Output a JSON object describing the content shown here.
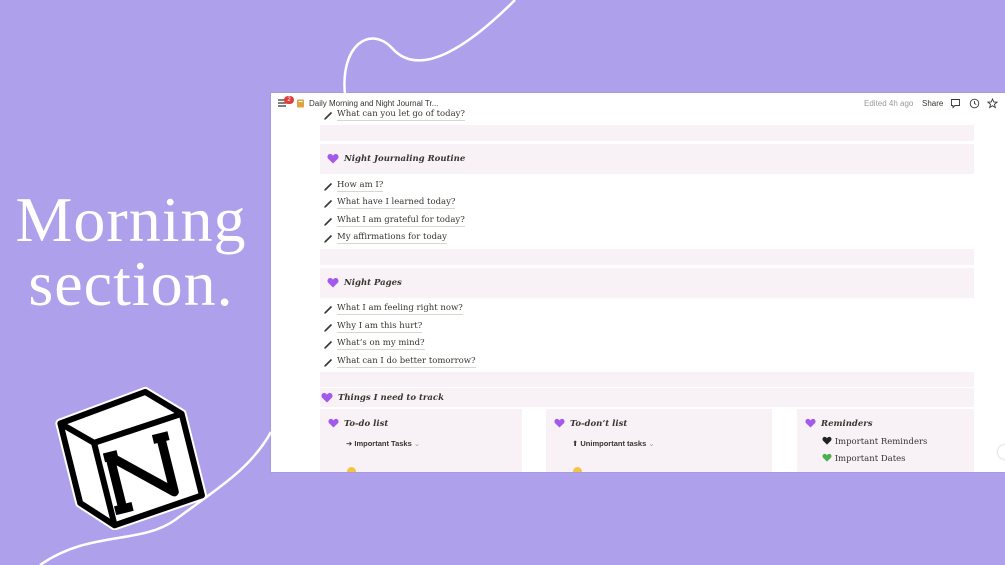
{
  "headline": {
    "line1": "Morning",
    "line2": "section."
  },
  "colors": {
    "background": "#afa0ec",
    "accent_heart": "#a259ec",
    "band": "#f8f1f6"
  },
  "app": {
    "title": "Daily Morning and Night Journal Tr...",
    "notification_count": "2",
    "edited": "Edited 4h ago",
    "share": "Share",
    "icons": [
      "menu-icon",
      "journal-icon",
      "comment-icon",
      "clock-icon",
      "star-icon"
    ]
  },
  "page": {
    "cut_off_item": "What can you let go of today?",
    "night_routine": {
      "heading": "Night Journaling Routine",
      "items": [
        "How am I?",
        "What have I learned today?",
        "What I am grateful for today?",
        "My affirmations for today"
      ]
    },
    "night_pages": {
      "heading": "Night Pages",
      "items": [
        "What I am feeling right now?",
        "Why I am this hurt?",
        "What’s on my mind?",
        "What can I do better tomorrow?"
      ]
    },
    "track": {
      "heading": "Things I need to track"
    },
    "cards": {
      "todo": {
        "title": "To-do list",
        "row": "Important Tasks"
      },
      "todont": {
        "title": "To-don’t list",
        "row": "Unimportant tasks"
      },
      "reminders": {
        "title": "Reminders",
        "rows": [
          "Important Reminders",
          "Important Dates"
        ]
      }
    }
  }
}
